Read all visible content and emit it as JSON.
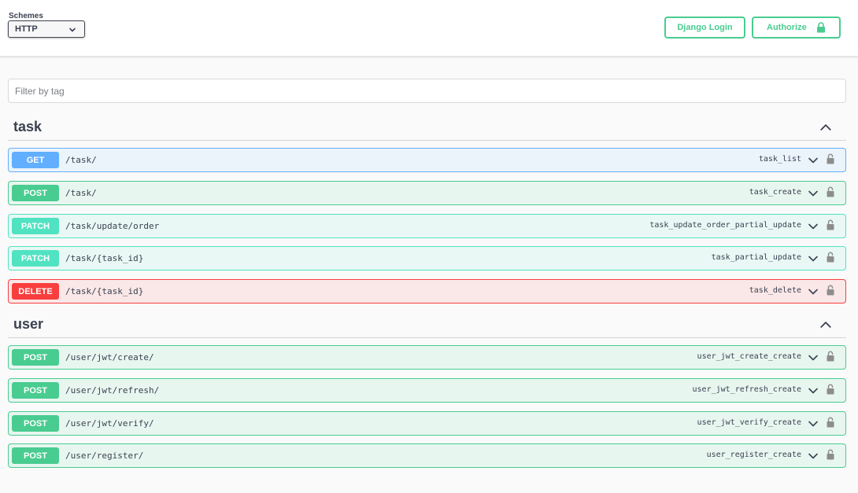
{
  "topbar": {
    "schemes_label": "Schemes",
    "scheme_selected": "HTTP",
    "django_login_label": "Django Login",
    "authorize_label": "Authorize"
  },
  "filter": {
    "placeholder": "Filter by tag"
  },
  "tags": [
    {
      "name": "task",
      "operations": [
        {
          "method": "GET",
          "path": "/task/",
          "id": "task_list"
        },
        {
          "method": "POST",
          "path": "/task/",
          "id": "task_create"
        },
        {
          "method": "PATCH",
          "path": "/task/update/order",
          "id": "task_update_order_partial_update"
        },
        {
          "method": "PATCH",
          "path": "/task/{task_id}",
          "id": "task_partial_update"
        },
        {
          "method": "DELETE",
          "path": "/task/{task_id}",
          "id": "task_delete"
        }
      ]
    },
    {
      "name": "user",
      "operations": [
        {
          "method": "POST",
          "path": "/user/jwt/create/",
          "id": "user_jwt_create_create"
        },
        {
          "method": "POST",
          "path": "/user/jwt/refresh/",
          "id": "user_jwt_refresh_create"
        },
        {
          "method": "POST",
          "path": "/user/jwt/verify/",
          "id": "user_jwt_verify_create"
        },
        {
          "method": "POST",
          "path": "/user/register/",
          "id": "user_register_create"
        }
      ]
    }
  ],
  "colors": {
    "get": "#61affe",
    "post": "#49cc90",
    "patch": "#50e3c2",
    "delete": "#f93e3e"
  },
  "icons": {
    "scheme_dropdown": "chevron-down-icon",
    "authorize": "lock-icon",
    "tag_toggle": "chevron-up-icon",
    "operation_expand": "chevron-down-icon",
    "operation_auth": "unlocked-padlock-icon"
  }
}
